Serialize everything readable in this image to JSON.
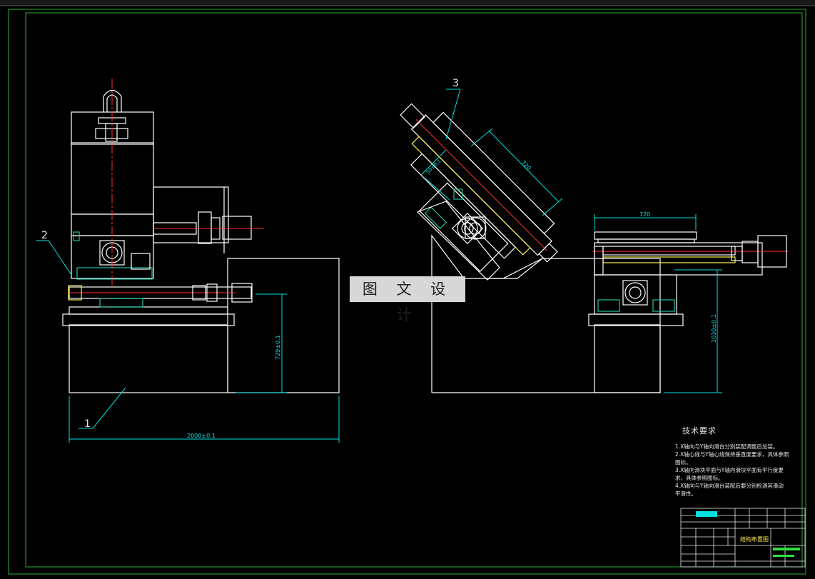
{
  "drawing": {
    "banner_text": "图 文 设 计",
    "balloons": [
      "1",
      "2",
      "3"
    ],
    "dimensions": {
      "base_length": "2000±0.1",
      "left_height": "729±0.1",
      "right_height": "1030±0.1",
      "table_width": "720",
      "inclined_length": "720",
      "inclined_offset": "50±0.1"
    },
    "tech_requirements_title": "技术要求",
    "tech_requirements": [
      "1.X轴向与Y轴向滑台分别装配调整后总装。",
      "2.X轴心线与Y轴心线保持垂直度要求，具体参照",
      "图标。",
      "3.X轴向滑块平面与Y轴向滑块平面有平行度要",
      "求，具体参照图标。",
      "4.X轴向与Y轴向滑台装配后要分别检测其滑动",
      "平滑性。"
    ],
    "title_block_name": "结构布置图",
    "colors": {
      "background": "#000000",
      "line": "#ffffff",
      "frame": "#2fae3a",
      "dimension": "#00e0e0",
      "centerline": "#e02020",
      "highlight": "#ffee55",
      "hatch": "#20c0a0"
    }
  }
}
